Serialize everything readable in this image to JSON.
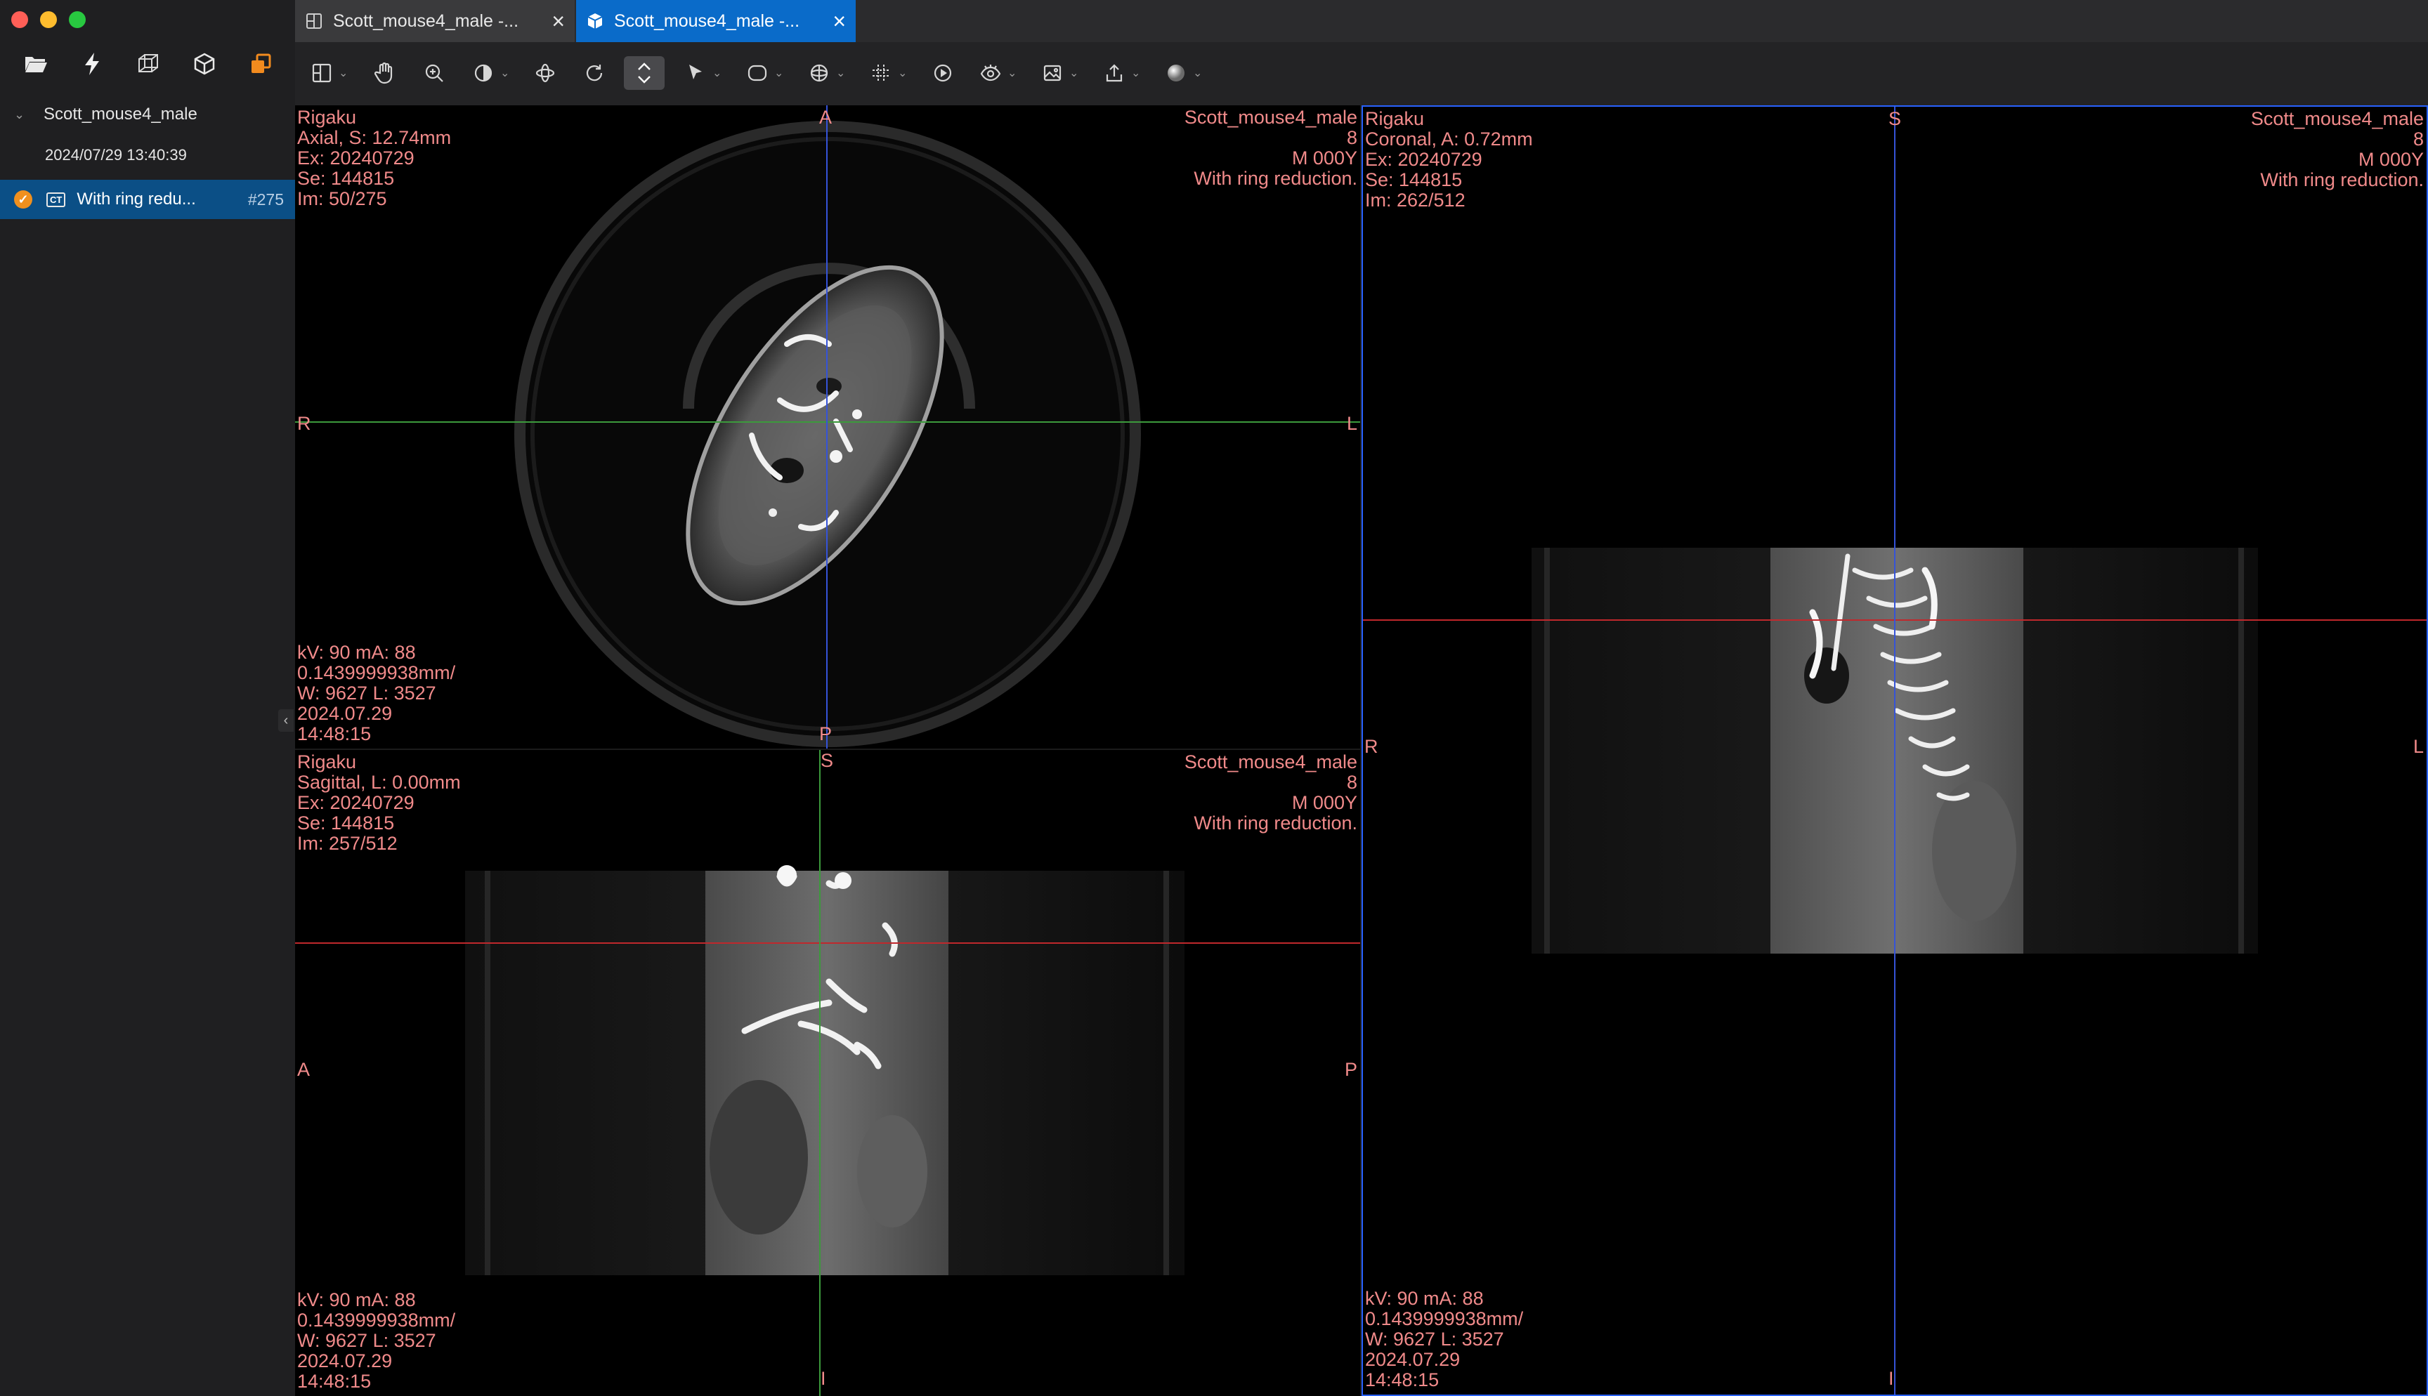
{
  "window": {
    "traffic_lights": [
      "close",
      "minimize",
      "zoom"
    ]
  },
  "sidebar": {
    "tools": [
      "folder-open-icon",
      "lightning-icon",
      "cube-wireframe-icon",
      "cube-solid-icon",
      "layers-orange-icon"
    ],
    "study_name": "Scott_mouse4_male",
    "study_datetime": "2024/07/29 13:40:39",
    "series": {
      "modality": "CT",
      "label": "With ring redu...",
      "count": "#275"
    }
  },
  "tabs": [
    {
      "label": "Scott_mouse4_male -...",
      "icon": "layout-icon",
      "active": false
    },
    {
      "label": "Scott_mouse4_male -...",
      "icon": "cube-icon",
      "active": true
    }
  ],
  "toolbar": {
    "items": [
      "layout-icon",
      "pan-hand-icon",
      "zoom-icon",
      "window-level-icon",
      "rotate-3d-icon",
      "rotate-icon",
      "scroll-slices-icon",
      "pointer-icon",
      "roi-icon",
      "sphere-icon",
      "crosshair-icon",
      "cine-play-icon",
      "visibility-icon",
      "image-icon",
      "export-icon",
      "shading-sphere-icon"
    ],
    "selected": "scroll-slices-icon"
  },
  "viewports": {
    "axial": {
      "top_left": "Rigaku\nAxial, S: 12.74mm\nEx: 20240729\nSe: 144815\nIm: 50/275",
      "top_right": "Scott_mouse4_male\n8\nM 000Y\nWith ring reduction.",
      "bottom_left": "kV: 90 mA: 88\n0.1439999938mm/\nW: 9627 L: 3527\n2024.07.29\n14:48:15",
      "orient_top": "A",
      "orient_bottom": "P",
      "orient_left": "R",
      "orient_right": "L"
    },
    "sagittal": {
      "top_left": "Rigaku\nSagittal, L: 0.00mm\nEx: 20240729\nSe: 144815\nIm: 257/512",
      "top_right": "Scott_mouse4_male\n8\nM 000Y\nWith ring reduction.",
      "bottom_left": "kV: 90 mA: 88\n0.1439999938mm/\nW: 9627 L: 3527\n2024.07.29\n14:48:15",
      "orient_top": "S",
      "orient_bottom": "I",
      "orient_left": "A",
      "orient_right": "P"
    },
    "coronal": {
      "top_left": "Rigaku\nCoronal, A: 0.72mm\nEx: 20240729\nSe: 144815\nIm: 262/512",
      "top_right": "Scott_mouse4_male\n8\nM 000Y\nWith ring reduction.",
      "bottom_left": "kV: 90 mA: 88\n0.1439999938mm/\nW: 9627 L: 3527\n2024.07.29\n14:48:15",
      "orient_top": "S",
      "orient_bottom": "I",
      "orient_left": "R",
      "orient_right": "L"
    }
  },
  "colors": {
    "overlay_text": "#f08a8a",
    "active_tab": "#0a6bc9",
    "crosshair_green": "#3c9a3c",
    "crosshair_blue": "#3553d8",
    "crosshair_red": "#c0282c"
  }
}
